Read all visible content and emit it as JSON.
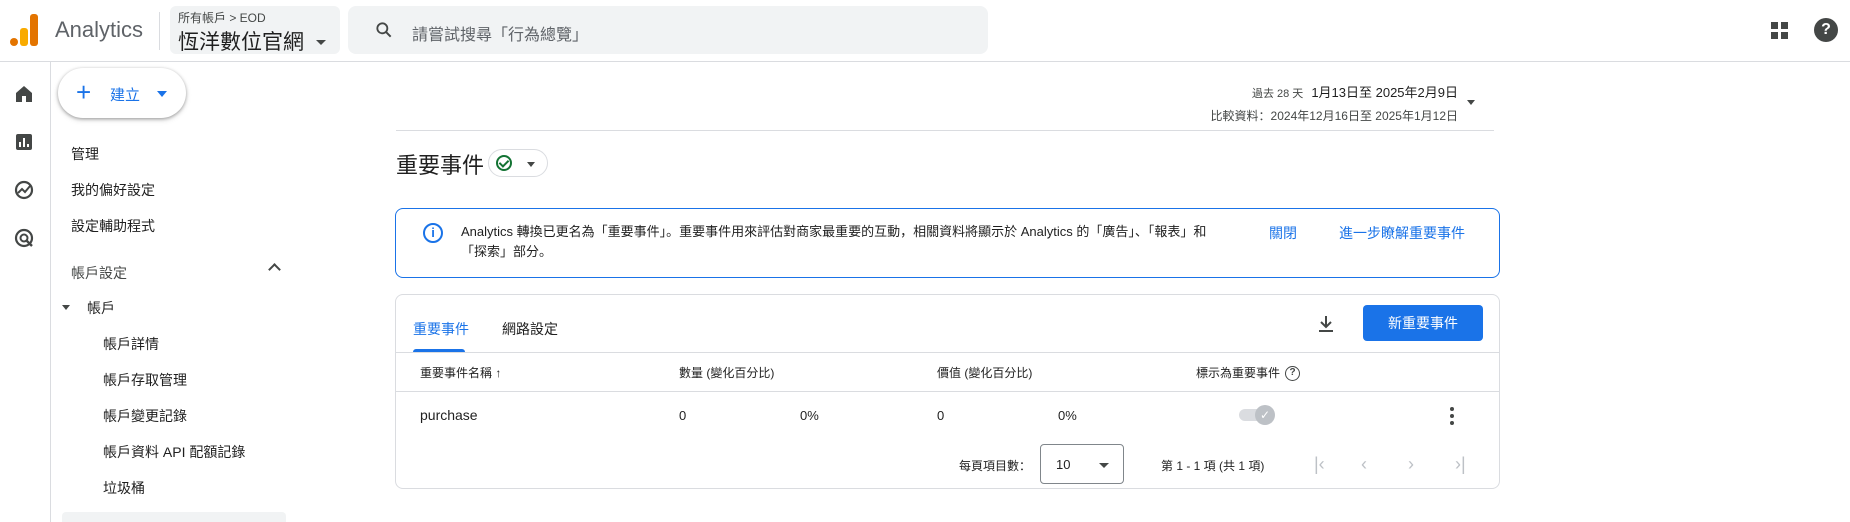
{
  "header": {
    "app_name": "Analytics",
    "breadcrumb": "所有帳戶 > EOD",
    "property_name": "恆洋數位官網",
    "search_placeholder": "請嘗試搜尋「行為總覽」"
  },
  "nav": {
    "create_label": "建立",
    "items": [
      "管理",
      "我的偏好設定",
      "設定輔助程式"
    ],
    "section_label": "帳戶設定",
    "account_label": "帳戶",
    "sub_items": [
      "帳戶詳情",
      "帳戶存取管理",
      "帳戶變更記錄",
      "帳戶資料 API 配額記錄",
      "垃圾桶"
    ]
  },
  "date_range": {
    "prefix": "過去 28 天",
    "range": "1月13日至 2025年2月9日",
    "compare": "比較資料：2024年12月16日至 2025年1月12日"
  },
  "page": {
    "title": "重要事件"
  },
  "banner": {
    "message": "Analytics 轉換已更名為「重要事件」。重要事件用來評估對商家最重要的互動，相關資料將顯示於 Analytics 的「廣告」、「報表」和「探索」部分。",
    "close_label": "關閉",
    "learn_label": "進一步瞭解重要事件"
  },
  "card": {
    "tabs": [
      "重要事件",
      "網路設定"
    ],
    "new_button": "新重要事件",
    "columns": [
      "重要事件名稱 ↑",
      "數量 (變化百分比)",
      "價值 (變化百分比)",
      "標示為重要事件"
    ],
    "rows": [
      {
        "name": "purchase",
        "count": "0",
        "count_change": "0%",
        "value": "0",
        "value_change": "0%",
        "marked": true
      }
    ],
    "pagination": {
      "per_page_label": "每頁項目數：",
      "per_page_value": "10",
      "range_text": "第 1 - 1 項 (共 1 項)"
    }
  },
  "colors": {
    "accent": "#1a73e8",
    "logo_orange": "#e37400",
    "logo_yellow": "#f9ab00",
    "success": "#137333"
  }
}
